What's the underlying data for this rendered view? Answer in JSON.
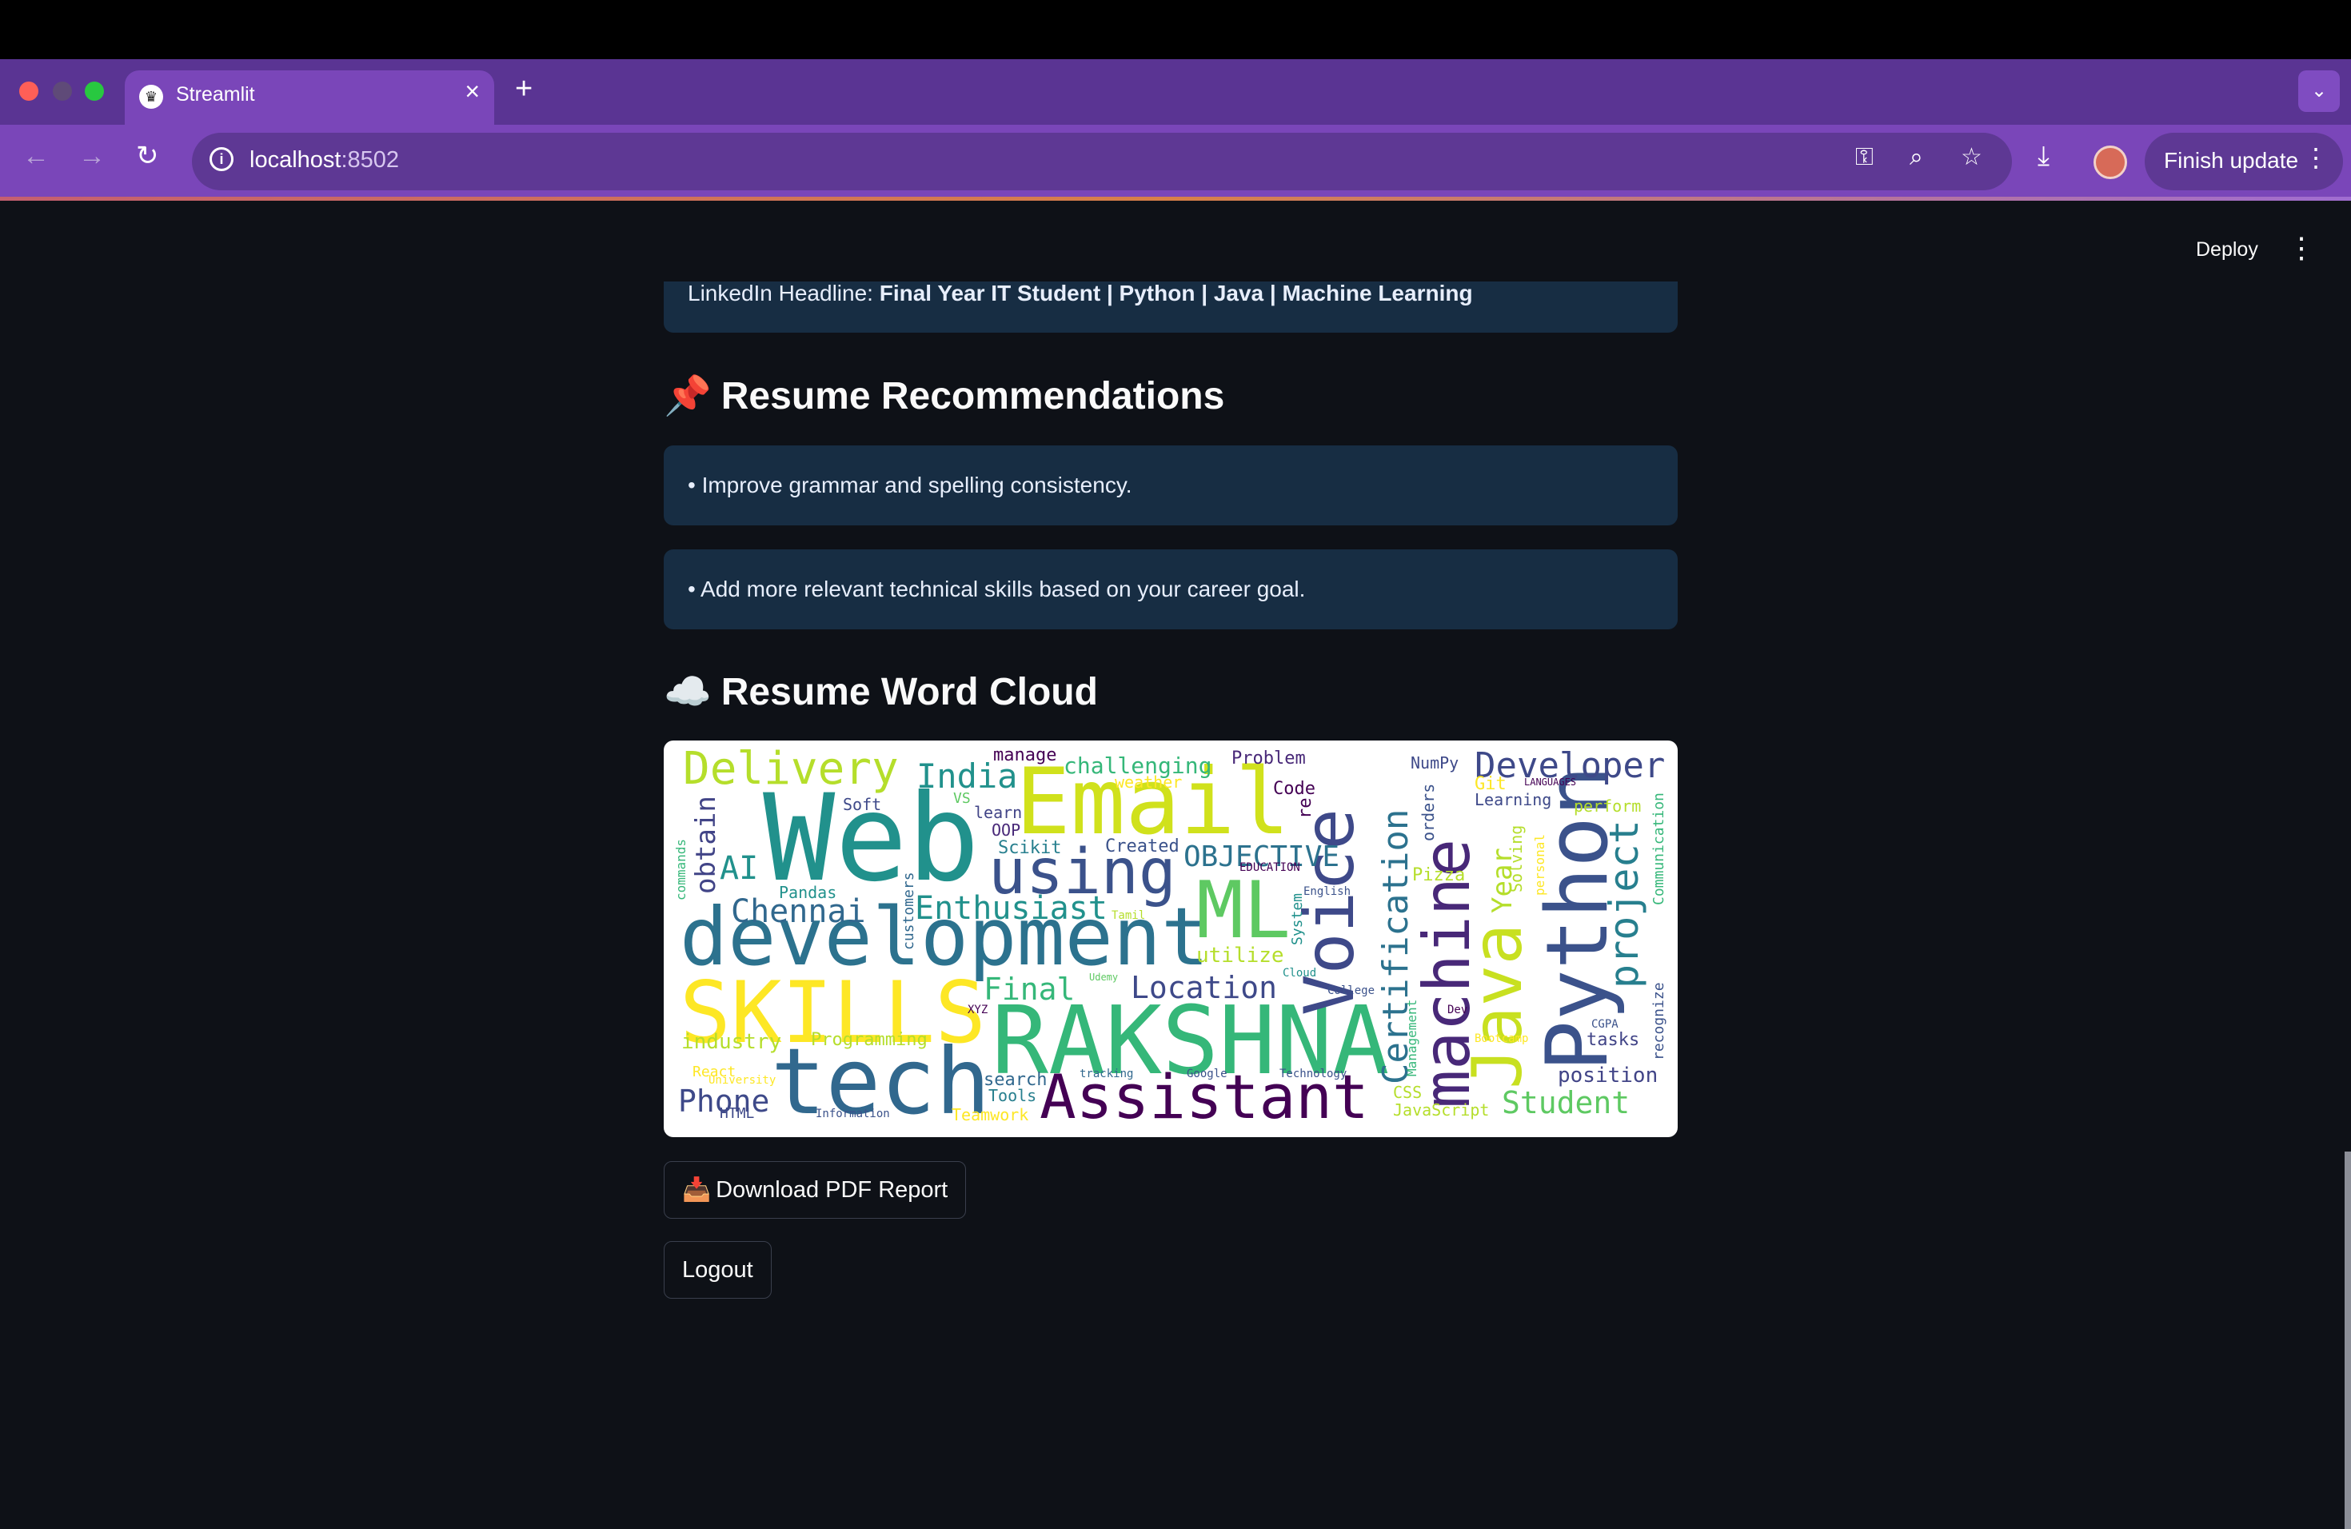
{
  "browser": {
    "tab_title": "Streamlit",
    "tab_close": "×",
    "new_tab": "+",
    "url_host": "localhost",
    "url_port": ":8502",
    "finish_update": "Finish update",
    "icons": [
      "back-arrow-icon",
      "forward-arrow-icon",
      "reload-icon",
      "info-icon",
      "key-icon",
      "zoom-icon",
      "star-icon",
      "download-icon",
      "profile-avatar",
      "more-vertical-icon"
    ]
  },
  "app": {
    "deploy": "Deploy",
    "menu_dots": "⋮",
    "linkedin_prefix": "LinkedIn Headline: ",
    "linkedin_bold": "Final Year IT Student | Python | Java | Machine Learning",
    "recommendations_title": "Resume Recommendations",
    "recommendations_icon": "📌",
    "recommendations": [
      "• Improve grammar and spelling consistency.",
      "• Add more relevant technical skills based on your career goal."
    ],
    "wordcloud_title": "Resume Word Cloud",
    "wordcloud_icon": "☁️",
    "download_button": "Download PDF Report",
    "download_icon": "📥",
    "logout_button": "Logout"
  },
  "wordcloud": [
    {
      "text": "Delivery"
    },
    {
      "text": "Web"
    },
    {
      "text": "Email"
    },
    {
      "text": "development"
    },
    {
      "text": "SKILLS"
    },
    {
      "text": "RAKSHNA"
    },
    {
      "text": "tech"
    },
    {
      "text": "Assistant"
    },
    {
      "text": "Voice"
    },
    {
      "text": "Python"
    },
    {
      "text": "Java"
    },
    {
      "text": "machine"
    },
    {
      "text": "ML"
    },
    {
      "text": "using"
    },
    {
      "text": "Developer"
    },
    {
      "text": "Certification"
    },
    {
      "text": "project"
    },
    {
      "text": "Enthusiast"
    },
    {
      "text": "Chennai"
    },
    {
      "text": "India"
    },
    {
      "text": "Location"
    },
    {
      "text": "Final"
    },
    {
      "text": "OBJECTIVE"
    },
    {
      "text": "Student"
    },
    {
      "text": "Phone"
    },
    {
      "text": "industry"
    },
    {
      "text": "Programming"
    },
    {
      "text": "position"
    },
    {
      "text": "challenging"
    },
    {
      "text": "Problem"
    },
    {
      "text": "Code"
    },
    {
      "text": "Scikit"
    },
    {
      "text": "Created"
    },
    {
      "text": "learn"
    },
    {
      "text": "OOP"
    },
    {
      "text": "Pandas"
    },
    {
      "text": "AI"
    },
    {
      "text": "obtain"
    },
    {
      "text": "Soft"
    },
    {
      "text": "manage"
    },
    {
      "text": "weather"
    },
    {
      "text": "NumPy"
    },
    {
      "text": "Learning"
    },
    {
      "text": "Git"
    },
    {
      "text": "perform"
    },
    {
      "text": "Year"
    },
    {
      "text": "Communication"
    },
    {
      "text": "recognize"
    },
    {
      "text": "tasks"
    },
    {
      "text": "CGPA"
    },
    {
      "text": "JavaScript"
    },
    {
      "text": "CSS"
    },
    {
      "text": "Tools"
    },
    {
      "text": "search"
    },
    {
      "text": "Teamwork"
    },
    {
      "text": "HTML"
    },
    {
      "text": "Information"
    },
    {
      "text": "React"
    },
    {
      "text": "University"
    },
    {
      "text": "tracking"
    },
    {
      "text": "Google"
    },
    {
      "text": "Technology"
    },
    {
      "text": "utilize"
    },
    {
      "text": "Cloud"
    },
    {
      "text": "College"
    },
    {
      "text": "Udemy"
    },
    {
      "text": "XYZ"
    },
    {
      "text": "commands"
    },
    {
      "text": "customers"
    },
    {
      "text": "Tamil"
    },
    {
      "text": "EDUCATION"
    },
    {
      "text": "English"
    },
    {
      "text": "orders"
    },
    {
      "text": "Pizza"
    },
    {
      "text": "System"
    },
    {
      "text": "Management"
    },
    {
      "text": "Solving"
    },
    {
      "text": "personal"
    },
    {
      "text": "LANGUAGES"
    },
    {
      "text": "Bootcamp"
    },
    {
      "text": "Dev"
    },
    {
      "text": "VS"
    },
    {
      "text": "re"
    }
  ]
}
